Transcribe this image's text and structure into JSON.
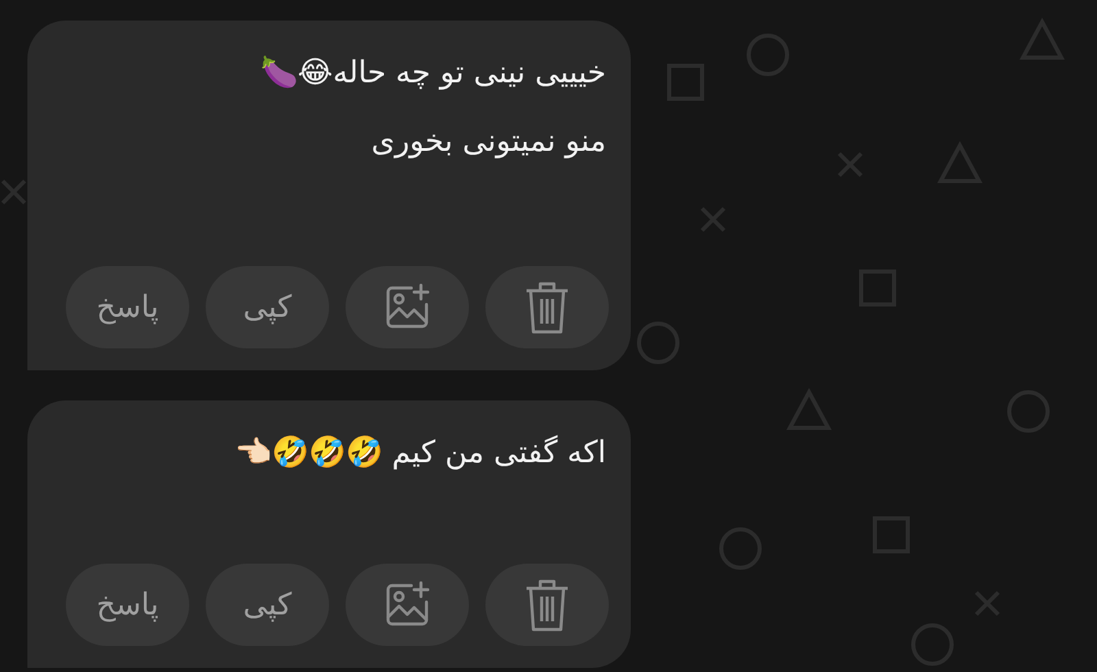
{
  "messages": [
    {
      "lines": [
        "خیییی نینی تو چه حاله😂🍆",
        "منو نمیتونی بخوری"
      ],
      "actions": [
        {
          "kind": "delete"
        },
        {
          "kind": "add_image"
        },
        {
          "kind": "text",
          "label": "کپی"
        },
        {
          "kind": "text",
          "label": "پاسخ"
        }
      ]
    },
    {
      "lines": [
        "اکه گفتی من کیم 🤣🤣🤣👈🏻"
      ],
      "actions": [
        {
          "kind": "delete"
        },
        {
          "kind": "add_image"
        },
        {
          "kind": "text",
          "label": "کپی"
        },
        {
          "kind": "text",
          "label": "پاسخ"
        }
      ]
    }
  ]
}
